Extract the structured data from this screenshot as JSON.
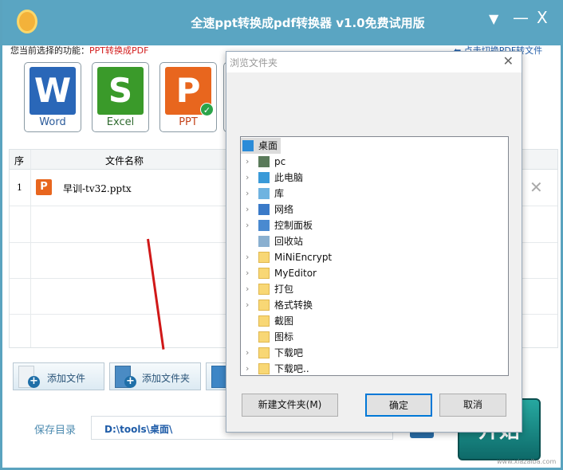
{
  "window": {
    "title": "全速ppt转换成pdf转换器 v1.0免费试用版",
    "minimize": "—",
    "close": "X",
    "menu": "▼"
  },
  "function": {
    "label": "您当前选择的功能：",
    "value": "PPT转换成PDF",
    "switch": "点击切换PDF转文件"
  },
  "cards": [
    {
      "label": "Word",
      "letter": "W",
      "color": "#2a67b8",
      "text_color": "#2a5a9a"
    },
    {
      "label": "Excel",
      "letter": "S",
      "color": "#3a9a2a",
      "text_color": "#2f6a2f"
    },
    {
      "label": "PPT",
      "letter": "P",
      "color": "#e8661e",
      "text_color": "#c4441c",
      "selected": true
    }
  ],
  "table": {
    "headers": [
      "序",
      "文件名称"
    ],
    "rows": [
      {
        "index": "1",
        "name": "早训-tv32.pptx"
      }
    ],
    "remove": "✕"
  },
  "buttons": {
    "add_file": "添加文件",
    "add_folder": "添加文件夹"
  },
  "save": {
    "label": "保存目录",
    "path": "D:\\tools\\桌面\\"
  },
  "start": "开始",
  "watermark": "www.xiazaiba.com",
  "dialog": {
    "title": "浏览文件夹",
    "close": "✕",
    "tree": [
      {
        "label": "桌面",
        "icon": "desktop",
        "selected": true,
        "root": true
      },
      {
        "label": "pc",
        "icon": "user",
        "expand": true
      },
      {
        "label": "此电脑",
        "icon": "computer",
        "expand": true
      },
      {
        "label": "库",
        "icon": "library",
        "expand": true
      },
      {
        "label": "网络",
        "icon": "network",
        "expand": true
      },
      {
        "label": "控制面板",
        "icon": "control-panel",
        "expand": true
      },
      {
        "label": "回收站",
        "icon": "recycle-bin",
        "expand": false
      },
      {
        "label": "MiNiEncrypt",
        "icon": "folder",
        "expand": true
      },
      {
        "label": "MyEditor",
        "icon": "folder",
        "expand": true
      },
      {
        "label": "打包",
        "icon": "folder",
        "expand": true
      },
      {
        "label": "格式转换",
        "icon": "folder",
        "expand": true
      },
      {
        "label": "截图",
        "icon": "folder",
        "expand": false
      },
      {
        "label": "图标",
        "icon": "folder",
        "expand": false
      },
      {
        "label": "下载吧",
        "icon": "folder",
        "expand": true
      },
      {
        "label": "下载吧..",
        "icon": "folder",
        "expand": true
      }
    ],
    "new_folder": "新建文件夹(M)",
    "ok": "确定",
    "cancel": "取消"
  }
}
